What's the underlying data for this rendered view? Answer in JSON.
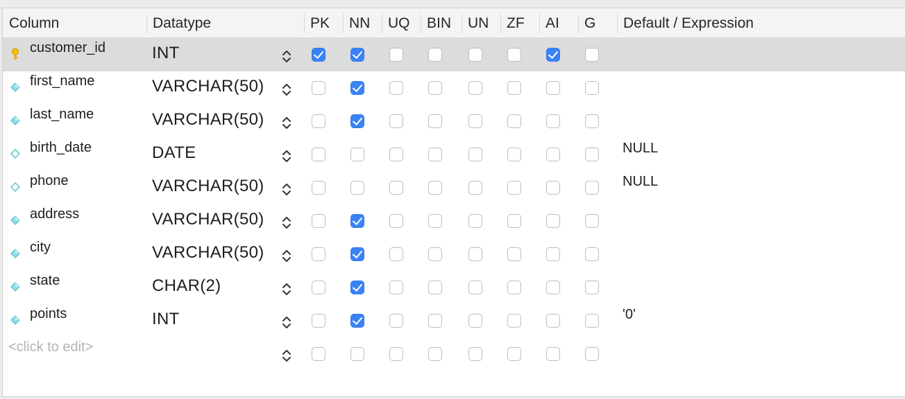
{
  "header": {
    "column": "Column",
    "datatype": "Datatype",
    "pk": "PK",
    "nn": "NN",
    "uq": "UQ",
    "bin": "BIN",
    "un": "UN",
    "zf": "ZF",
    "ai": "AI",
    "g": "G",
    "default": "Default / Expression"
  },
  "rows": [
    {
      "name": "customer_id",
      "type": "INT",
      "default": "",
      "icon": "primary-key-icon",
      "flags": [
        true,
        true,
        false,
        false,
        false,
        false,
        true,
        false
      ]
    },
    {
      "name": "first_name",
      "type": "VARCHAR(50)",
      "default": "",
      "icon": "column-diamond-filled-icon",
      "flags": [
        false,
        true,
        false,
        false,
        false,
        false,
        false,
        false
      ]
    },
    {
      "name": "last_name",
      "type": "VARCHAR(50)",
      "default": "",
      "icon": "column-diamond-filled-icon",
      "flags": [
        false,
        true,
        false,
        false,
        false,
        false,
        false,
        false
      ]
    },
    {
      "name": "birth_date",
      "type": "DATE",
      "default": "NULL",
      "icon": "column-diamond-outline-icon",
      "flags": [
        false,
        false,
        false,
        false,
        false,
        false,
        false,
        false
      ]
    },
    {
      "name": "phone",
      "type": "VARCHAR(50)",
      "default": "NULL",
      "icon": "column-diamond-outline-icon",
      "flags": [
        false,
        false,
        false,
        false,
        false,
        false,
        false,
        false
      ]
    },
    {
      "name": "address",
      "type": "VARCHAR(50)",
      "default": "",
      "icon": "column-diamond-filled-icon",
      "flags": [
        false,
        true,
        false,
        false,
        false,
        false,
        false,
        false
      ]
    },
    {
      "name": "city",
      "type": "VARCHAR(50)",
      "default": "",
      "icon": "column-diamond-filled-icon",
      "flags": [
        false,
        true,
        false,
        false,
        false,
        false,
        false,
        false
      ]
    },
    {
      "name": "state",
      "type": "CHAR(2)",
      "default": "",
      "icon": "column-diamond-filled-icon",
      "flags": [
        false,
        true,
        false,
        false,
        false,
        false,
        false,
        false
      ]
    },
    {
      "name": "points",
      "type": "INT",
      "default": "'0'",
      "icon": "column-diamond-filled-icon",
      "flags": [
        false,
        true,
        false,
        false,
        false,
        false,
        false,
        false
      ]
    }
  ],
  "new_row": {
    "placeholder": "<click to edit>",
    "flags": [
      false,
      false,
      false,
      false,
      false,
      false,
      false,
      false
    ]
  },
  "selected_row": 0,
  "colors": {
    "accent": "#3b82f6",
    "selected_row": "#dcdcdc",
    "header_bg": "#f4f4f4",
    "placeholder": "#b3b3b3",
    "key_icon": "#e8b800",
    "column_icon": "#7fd3dc"
  }
}
